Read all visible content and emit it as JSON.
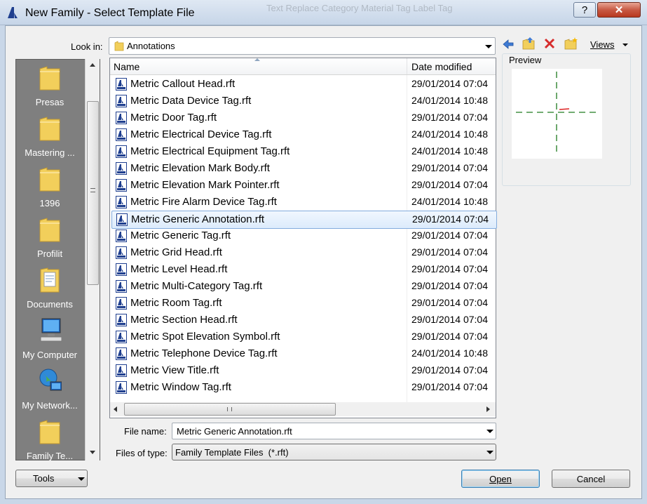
{
  "window": {
    "title": "New Family - Select Template File",
    "help_glyph": "?",
    "close_glyph": "✕",
    "background_toolbar_text": "Text  Replace  Category  Material Tag  Label Tag"
  },
  "look_in": {
    "label": "Look in:",
    "value": "Annotations",
    "views_label": "Views"
  },
  "toolbar_icons": [
    "back-arrow-icon",
    "up-folder-icon",
    "delete-icon",
    "new-folder-icon"
  ],
  "places": [
    {
      "label": "Presas",
      "icon": "folder-icon"
    },
    {
      "label": "Mastering ...",
      "icon": "folder-icon"
    },
    {
      "label": "1396",
      "icon": "folder-icon"
    },
    {
      "label": "Profilit",
      "icon": "folder-icon"
    },
    {
      "label": "Documents",
      "icon": "documents-icon"
    },
    {
      "label": "My Computer",
      "icon": "computer-icon"
    },
    {
      "label": "My Network...",
      "icon": "network-icon"
    },
    {
      "label": "Family Te...",
      "icon": "folder-icon"
    }
  ],
  "columns": {
    "name": "Name",
    "date": "Date modified"
  },
  "files": [
    {
      "name": "Metric Callout Head.rft",
      "date": "29/01/2014 07:04"
    },
    {
      "name": "Metric Data Device Tag.rft",
      "date": "24/01/2014 10:48"
    },
    {
      "name": "Metric Door Tag.rft",
      "date": "29/01/2014 07:04"
    },
    {
      "name": "Metric Electrical Device Tag.rft",
      "date": "24/01/2014 10:48"
    },
    {
      "name": "Metric Electrical Equipment Tag.rft",
      "date": "24/01/2014 10:48"
    },
    {
      "name": "Metric Elevation Mark Body.rft",
      "date": "29/01/2014 07:04"
    },
    {
      "name": "Metric Elevation Mark Pointer.rft",
      "date": "29/01/2014 07:04"
    },
    {
      "name": "Metric Fire Alarm Device Tag.rft",
      "date": "24/01/2014 10:48"
    },
    {
      "name": "Metric Generic Annotation.rft",
      "date": "29/01/2014 07:04",
      "selected": true
    },
    {
      "name": "Metric Generic Tag.rft",
      "date": "29/01/2014 07:04"
    },
    {
      "name": "Metric Grid Head.rft",
      "date": "29/01/2014 07:04"
    },
    {
      "name": "Metric Level Head.rft",
      "date": "29/01/2014 07:04"
    },
    {
      "name": "Metric Multi-Category Tag.rft",
      "date": "29/01/2014 07:04"
    },
    {
      "name": "Metric Room Tag.rft",
      "date": "29/01/2014 07:04"
    },
    {
      "name": "Metric Section Head.rft",
      "date": "29/01/2014 07:04"
    },
    {
      "name": "Metric Spot Elevation Symbol.rft",
      "date": "29/01/2014 07:04"
    },
    {
      "name": "Metric Telephone Device Tag.rft",
      "date": "24/01/2014 10:48"
    },
    {
      "name": "Metric View Title.rft",
      "date": "29/01/2014 07:04"
    },
    {
      "name": "Metric Window Tag.rft",
      "date": "29/01/2014 07:04"
    }
  ],
  "preview": {
    "label": "Preview"
  },
  "file_name": {
    "label": "File name:",
    "value": "Metric Generic Annotation.rft"
  },
  "file_type": {
    "label": "Files of type:",
    "value": "Family Template Files  (*.rft)"
  },
  "buttons": {
    "tools": "Tools",
    "open": "Open",
    "cancel": "Cancel"
  },
  "colors": {
    "folder": "#f2cf5b",
    "selection": "#dcebfc",
    "places_bg": "#7f7f7f",
    "delete": "#d62c2c",
    "back_arrow": "#3f7bd4"
  }
}
